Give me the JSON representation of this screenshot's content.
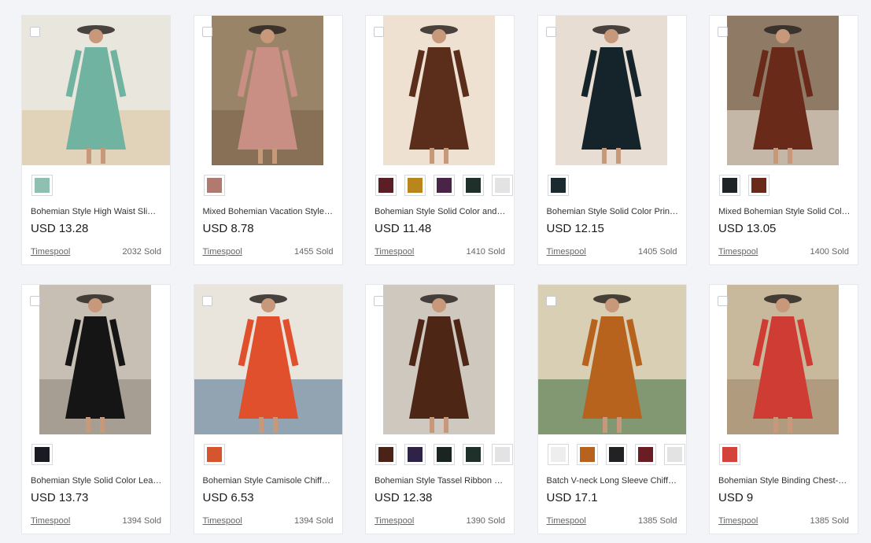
{
  "products": [
    {
      "title": "Bohemian Style High Waist Slim Floral Print Dress",
      "price": "USD 13.28",
      "seller": "Timespool",
      "sold": "2032 Sold",
      "photo": {
        "bg": "#e9e6de",
        "dress": "#6fb3a0",
        "accent": "#d9c39a",
        "skin": "#c8987a"
      },
      "swatches": [
        "#8fbfb0"
      ]
    },
    {
      "title": "Mixed Bohemian Vacation Style Dress",
      "price": "USD 8.78",
      "seller": "Timespool",
      "sold": "1455 Sold",
      "photo": {
        "bg": "#9a8467",
        "dress": "#c98f85",
        "accent": "#7a6148",
        "skin": "#c8987a"
      },
      "swatches": [
        "#b07a70"
      ]
    },
    {
      "title": "Bohemian Style Solid Color and Velvet Dress",
      "price": "USD 11.48",
      "seller": "Timespool",
      "sold": "1410 Sold",
      "photo": {
        "bg": "#efe1d2",
        "dress": "#5a2e1b",
        "accent": "#efe1d2",
        "skin": "#c8987a"
      },
      "swatches": [
        "#5a1e24",
        "#b8861c",
        "#4a2446",
        "#1f2f2a",
        "#e3e3e3"
      ]
    },
    {
      "title": "Bohemian Style Solid Color Print Dress",
      "price": "USD 12.15",
      "seller": "Timespool",
      "sold": "1405 Sold",
      "photo": {
        "bg": "#e8ddd2",
        "dress": "#14242a",
        "accent": "#e8ddd2",
        "skin": "#c8987a"
      },
      "swatches": [
        "#1a2a2e"
      ]
    },
    {
      "title": "Mixed Bohemian Style Solid Color Jacket",
      "price": "USD 13.05",
      "seller": "Timespool",
      "sold": "1400 Sold",
      "photo": {
        "bg": "#8f7a66",
        "dress": "#6a2a1a",
        "accent": "#f1e9dc",
        "skin": "#c8987a"
      },
      "swatches": [
        "#1e2326",
        "#6a2a1a"
      ]
    },
    {
      "title": "Bohemian Style Solid Color Lean Dress",
      "price": "USD 13.73",
      "seller": "Timespool",
      "sold": "1394 Sold",
      "photo": {
        "bg": "#c8bfb4",
        "dress": "#151515",
        "accent": "#8b8477",
        "skin": "#c8987a"
      },
      "swatches": [
        "#1a1a22"
      ]
    },
    {
      "title": "Bohemian Style Camisole Chiffon Top",
      "price": "USD 6.53",
      "seller": "Timespool",
      "sold": "1394 Sold",
      "photo": {
        "bg": "#e9e4dc",
        "dress": "#e0502c",
        "accent": "#4a6d90",
        "skin": "#c8987a"
      },
      "swatches": [
        "#d7552e"
      ]
    },
    {
      "title": "Bohemian Style Tassel Ribbon Embroidered Dress",
      "price": "USD 12.38",
      "seller": "Timespool",
      "sold": "1390 Sold",
      "photo": {
        "bg": "#cfc8bf",
        "dress": "#4e2616",
        "accent": "#cfc8bf",
        "skin": "#c8987a"
      },
      "swatches": [
        "#4a2218",
        "#2e2246",
        "#1a2420",
        "#1f2f2a",
        "#e3e3e3"
      ]
    },
    {
      "title": "Batch V-neck Long Sleeve Chiffon Dress",
      "price": "USD 17.1",
      "seller": "Timespool",
      "sold": "1385 Sold",
      "photo": {
        "bg": "#d9cfb5",
        "dress": "#b8631d",
        "accent": "#3a6b3a",
        "skin": "#c8987a"
      },
      "swatches": [
        "#eeeeee",
        "#b8631d",
        "#222",
        "#6a1e24",
        "#e3e3e3"
      ]
    },
    {
      "title": "Bohemian Style Binding Chest-wrapped Dress",
      "price": "USD 9",
      "seller": "Timespool",
      "sold": "1385 Sold",
      "photo": {
        "bg": "#c9b99c",
        "dress": "#cf3c33",
        "accent": "#9a8467",
        "skin": "#c8987a"
      },
      "swatches": [
        "#d4433a"
      ]
    }
  ]
}
